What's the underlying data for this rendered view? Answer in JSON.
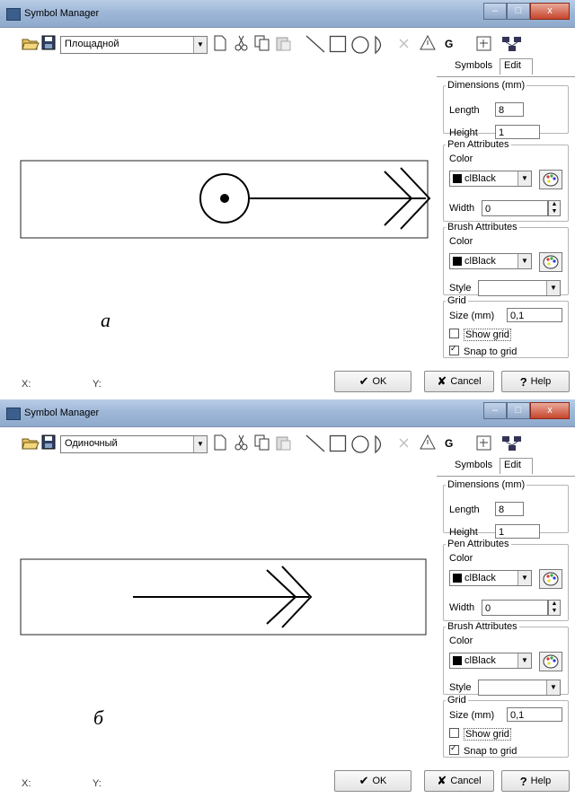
{
  "windows": [
    {
      "title": "Symbol Manager",
      "caption_buttons": {
        "minimize": "–",
        "maximize": "□",
        "close": "x"
      },
      "toolbar": {
        "combo_value": "Площадной",
        "grid_button_label": "G"
      },
      "tabs": [
        "Symbols",
        "Edit"
      ],
      "dimensions": {
        "legend": "Dimensions (mm)",
        "length_label": "Length",
        "length_value": "8",
        "height_label": "Height",
        "height_value": "1"
      },
      "pen": {
        "legend": "Pen Attributes",
        "color_label": "Color",
        "color_value": "clBlack",
        "width_label": "Width",
        "width_value": "0"
      },
      "brush": {
        "legend": "Brush Attributes",
        "color_label": "Color",
        "color_value": "clBlack",
        "style_label": "Style",
        "style_value": ""
      },
      "grid": {
        "legend": "Grid",
        "size_label": "Size (mm)",
        "size_value": "0,1",
        "show_grid_label": "Show grid",
        "show_grid_checked": false,
        "snap_label": "Snap to grid",
        "snap_checked": true
      },
      "status": {
        "x_label": "X:",
        "y_label": "Y:"
      },
      "buttons": {
        "ok": "OK",
        "cancel": "Cancel",
        "help": "Help"
      },
      "caption_letter": "а",
      "symbol": "circle-with-arrow"
    },
    {
      "title": "Symbol Manager",
      "caption_buttons": {
        "minimize": "–",
        "maximize": "□",
        "close": "x"
      },
      "toolbar": {
        "combo_value": "Одиночный",
        "grid_button_label": "G"
      },
      "tabs": [
        "Symbols",
        "Edit"
      ],
      "dimensions": {
        "legend": "Dimensions (mm)",
        "length_label": "Length",
        "length_value": "8",
        "height_label": "Height",
        "height_value": "1"
      },
      "pen": {
        "legend": "Pen Attributes",
        "color_label": "Color",
        "color_value": "clBlack",
        "width_label": "Width",
        "width_value": "0"
      },
      "brush": {
        "legend": "Brush Attributes",
        "color_label": "Color",
        "color_value": "clBlack",
        "style_label": "Style",
        "style_value": ""
      },
      "grid": {
        "legend": "Grid",
        "size_label": "Size (mm)",
        "size_value": "0,1",
        "show_grid_label": "Show grid",
        "show_grid_checked": false,
        "snap_label": "Snap to grid",
        "snap_checked": true
      },
      "status": {
        "x_label": "X:",
        "y_label": "Y:"
      },
      "buttons": {
        "ok": "OK",
        "cancel": "Cancel",
        "help": "Help"
      },
      "caption_letter": "б",
      "symbol": "arrow"
    }
  ]
}
